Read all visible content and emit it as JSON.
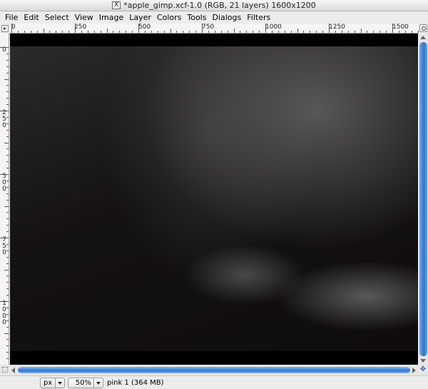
{
  "window": {
    "title": "*apple_gimp.xcf-1.0 (RGB, 21 layers) 1600x1200"
  },
  "menubar": {
    "items": [
      {
        "label": "File"
      },
      {
        "label": "Edit"
      },
      {
        "label": "Select"
      },
      {
        "label": "View"
      },
      {
        "label": "Image"
      },
      {
        "label": "Layer"
      },
      {
        "label": "Colors"
      },
      {
        "label": "Tools"
      },
      {
        "label": "Dialogs"
      },
      {
        "label": "Filters"
      }
    ]
  },
  "rulers": {
    "horizontal_labels": [
      "0",
      "250",
      "500",
      "750",
      "1000",
      "1250",
      "1500"
    ],
    "vertical_labels": [
      "0",
      "250",
      "500",
      "750",
      "1000"
    ]
  },
  "statusbar": {
    "unit": "px",
    "zoom": "50%",
    "message": "pink 1 (364 MB)"
  },
  "icons": {
    "window": "x11-icon",
    "ruler_menu": "menu-arrow-icon",
    "zoom": "zoom-icon",
    "navigate": "navigate-icon"
  }
}
